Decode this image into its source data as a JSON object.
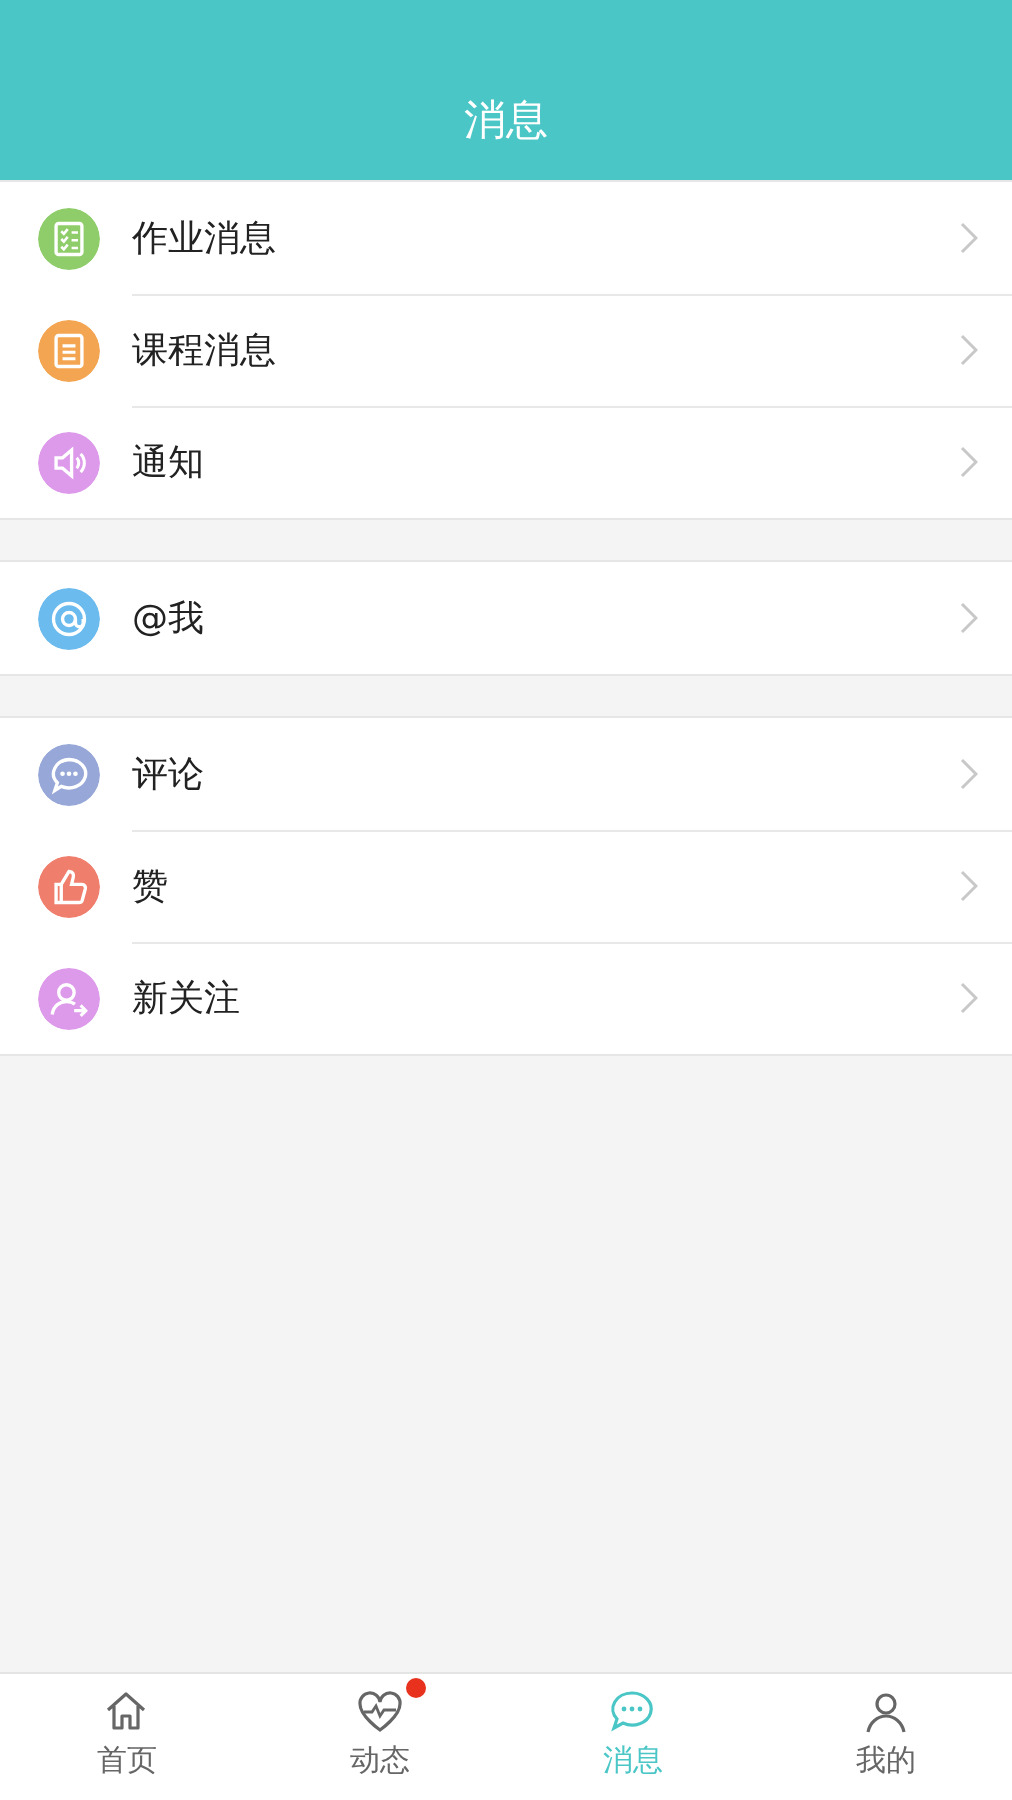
{
  "header": {
    "title": "消息"
  },
  "groups": [
    {
      "items": [
        {
          "label": "作业消息",
          "color": "#8fcd6a"
        },
        {
          "label": "课程消息",
          "color": "#f3a552"
        },
        {
          "label": "通知",
          "color": "#dd99ea"
        }
      ]
    },
    {
      "items": [
        {
          "label": "@我",
          "color": "#6cbbee"
        }
      ]
    },
    {
      "items": [
        {
          "label": "评论",
          "color": "#96a7d8"
        },
        {
          "label": "赞",
          "color": "#f07e6c"
        },
        {
          "label": "新关注",
          "color": "#dd99ea"
        }
      ]
    }
  ],
  "tabs": [
    {
      "label": "首页",
      "selected": false,
      "badge": false
    },
    {
      "label": "动态",
      "selected": false,
      "badge": true
    },
    {
      "label": "消息",
      "selected": true,
      "badge": false
    },
    {
      "label": "我的",
      "selected": false,
      "badge": false
    }
  ]
}
